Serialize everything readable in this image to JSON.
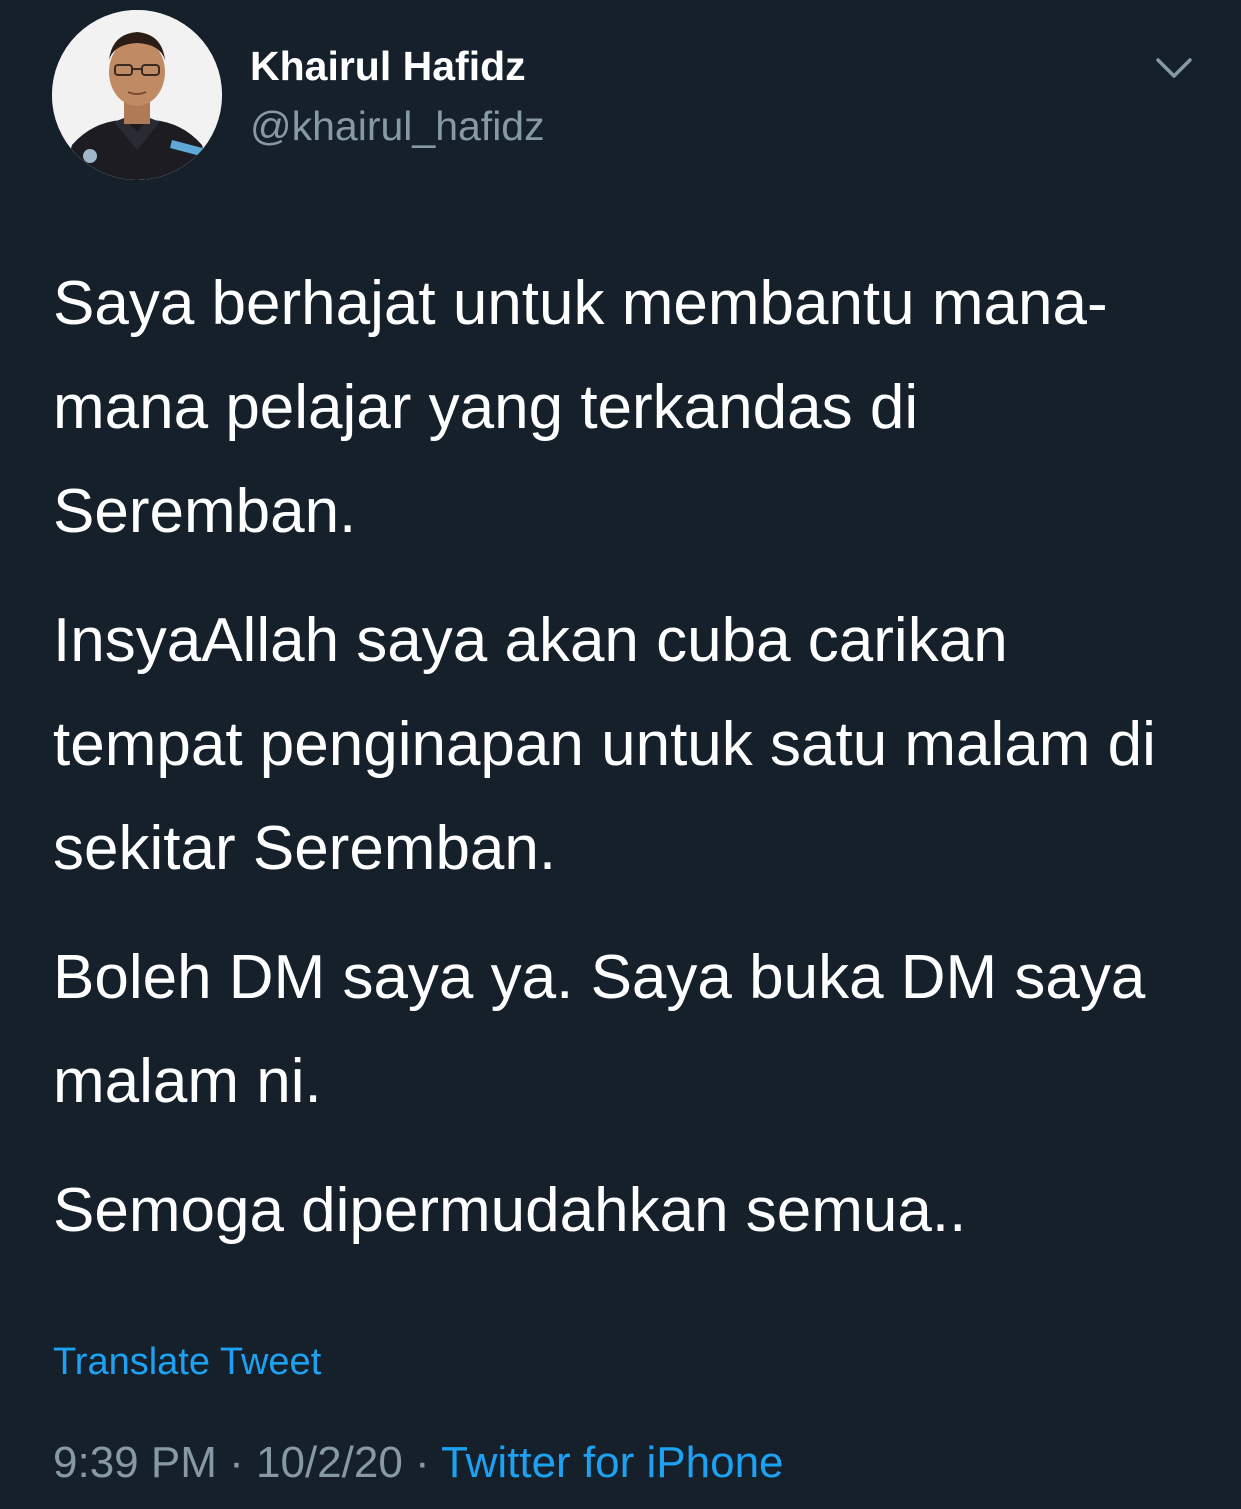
{
  "tweet": {
    "author": {
      "name": "Khairul Hafidz",
      "handle": "@khairul_hafidz"
    },
    "paragraphs": [
      "Saya berhajat untuk membantu mana-mana pelajar yang terkandas di Seremban.",
      "InsyaAllah saya akan cuba carikan tempat penginapan untuk satu malam di sekitar Seremban.",
      "Boleh DM saya ya. Saya buka DM saya malam ni.",
      "Semoga dipermudahkan semua.."
    ],
    "translate_label": "Translate Tweet",
    "time": "9:39 PM",
    "separator": "·",
    "date": "10/2/20",
    "source": "Twitter for iPhone"
  },
  "icons": {
    "more": "chevron-down-icon"
  },
  "colors": {
    "background": "#15202b",
    "text": "#ffffff",
    "secondary_text": "#8899a6",
    "link": "#1da1f2"
  }
}
